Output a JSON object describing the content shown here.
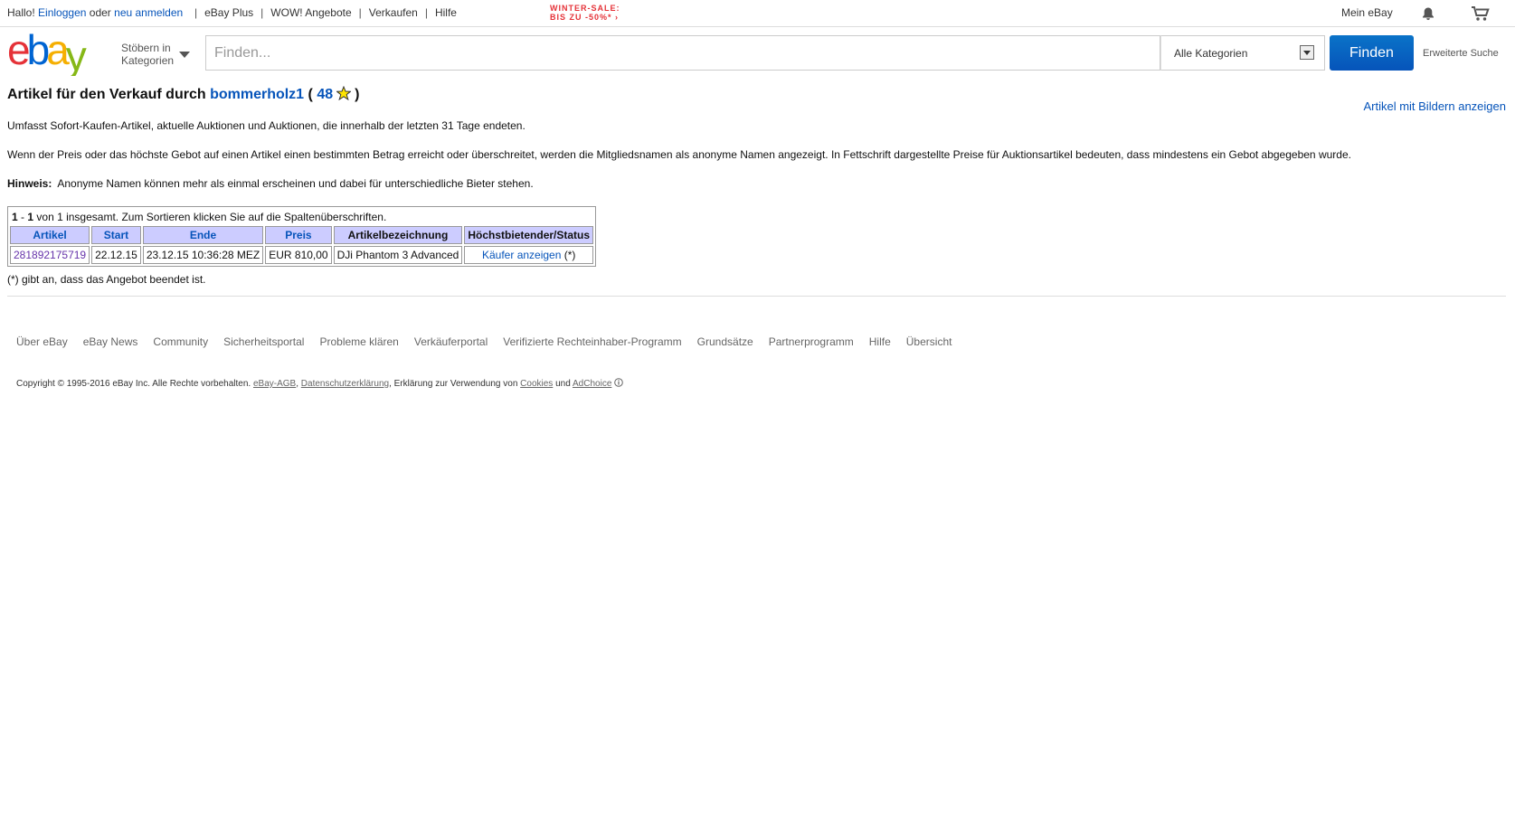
{
  "topbar": {
    "greeting": "Hallo!",
    "login": "Einloggen",
    "or": "oder",
    "register": "neu anmelden",
    "links": [
      "eBay Plus",
      "WOW! Angebote",
      "Verkaufen",
      "Hilfe"
    ],
    "sale_line1": "WINTER-SALE:",
    "sale_line2": "BIS ZU -50%* ›",
    "my_ebay": "Mein eBay",
    "bell_icon": "bell-icon",
    "cart_icon": "cart-icon"
  },
  "header": {
    "logo_letters": [
      "e",
      "b",
      "a",
      "y"
    ],
    "logo_colors": [
      "#e53238",
      "#0064d2",
      "#f5af02",
      "#86b817"
    ],
    "browse_line1": "Stöbern in",
    "browse_line2": "Kategorien",
    "search_placeholder": "Finden...",
    "category": "Alle Kategorien",
    "find_button": "Finden",
    "advanced_search": "Erweiterte Suche",
    "accent_color": "#0654ba"
  },
  "main": {
    "title_prefix": "Artikel für den Verkauf durch",
    "seller": "bommerholz1",
    "open_paren": "(",
    "feedback": "48",
    "close_paren": ")",
    "with_images": "Artikel mit Bildern anzeigen",
    "para1": "Umfasst Sofort-Kaufen-Artikel, aktuelle Auktionen und Auktionen, die innerhalb der letzten 31 Tage endeten.",
    "para2": "Wenn der Preis oder das höchste Gebot auf einen Artikel einen bestimmten Betrag erreicht oder überschreitet, werden die Mitgliedsnamen als anonyme Namen angezeigt. In Fettschrift dargestellte Preise für Auktionsartikel bedeuten, dass mindestens ein Gebot abgegeben wurde.",
    "note_label": "Hinweis:",
    "note_text": "Anonyme Namen können mehr als einmal erscheinen und dabei für unterschiedliche Bieter stehen.",
    "table": {
      "range_start": "1",
      "range_dash": "-",
      "range_end": "1",
      "count_text": "von 1 insgesamt. Zum Sortieren klicken Sie auf die Spaltenüberschriften.",
      "headers": [
        "Artikel",
        "Start",
        "Ende",
        "Preis",
        "Artikelbezeichnung",
        "Höchstbietender/Status"
      ],
      "rows": [
        {
          "item": "281892175719",
          "start": "22.12.15",
          "end": "23.12.15 10:36:28 MEZ",
          "price": "EUR 810,00",
          "title": "DJi Phantom 3 Advanced",
          "status_link": "Käufer anzeigen",
          "status_suffix": "(*)"
        }
      ]
    },
    "footnote": "(*) gibt an, dass das Angebot beendet ist."
  },
  "footer": {
    "links": [
      "Über eBay",
      "eBay News",
      "Community",
      "Sicherheitsportal",
      "Probleme klären",
      "Verkäuferportal",
      "Verifizierte Rechteinhaber-Programm",
      "Grundsätze",
      "Partnerprogramm",
      "Hilfe",
      "Übersicht"
    ],
    "copyright": "Copyright © 1995-2016 eBay Inc. Alle Rechte vorbehalten.",
    "agb": "eBay-AGB",
    "comma1": ",",
    "privacy": "Datenschutzerklärung",
    "cookies_text": ", Erklärung zur Verwendung von",
    "cookies": "Cookies",
    "and": "und",
    "adchoice": "AdChoice"
  }
}
